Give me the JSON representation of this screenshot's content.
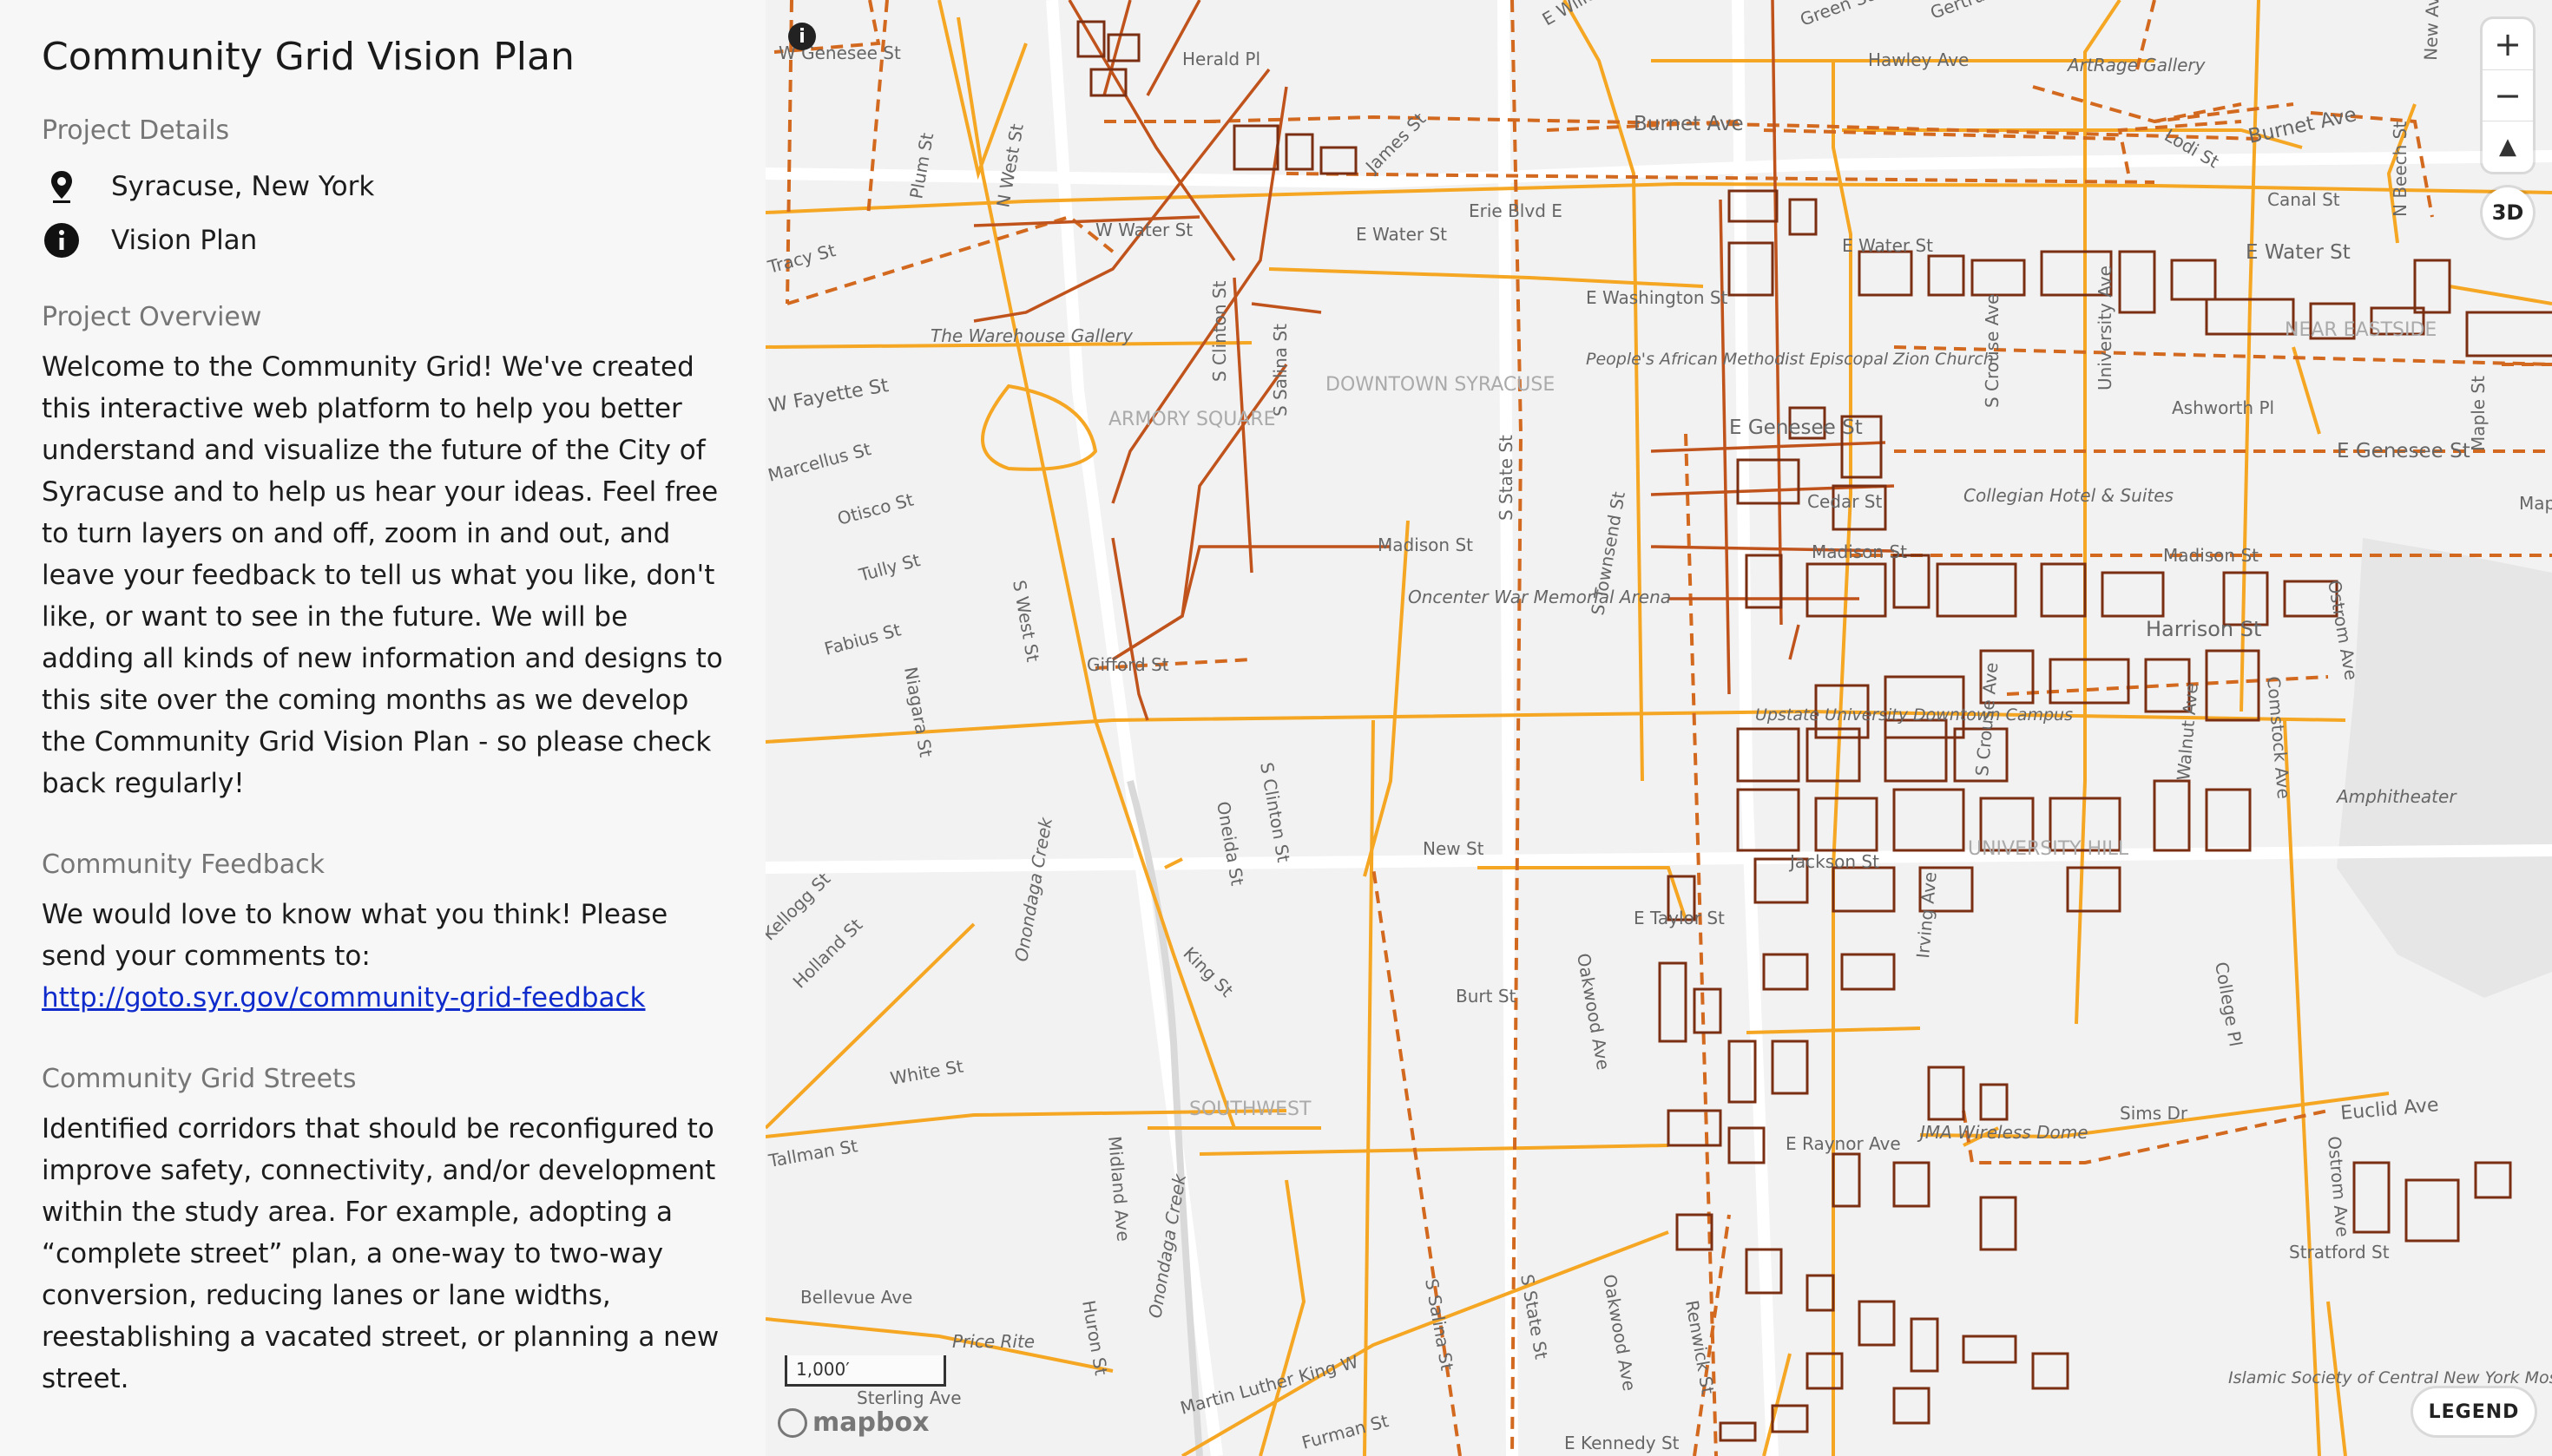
{
  "sidebar": {
    "title": "Community Grid Vision Plan",
    "details_heading": "Project Details",
    "location": "Syracuse, New York",
    "plan_type": "Vision Plan",
    "overview_heading": "Project Overview",
    "overview_text": "Welcome to the Community Grid! We've created this interactive web platform to help you better understand and visualize the future of the City of Syracuse and to help us hear your ideas. Feel free to turn layers on and off, zoom in and out, and leave your feedback to tell us what you like, don't like, or want to see in the future. We will be adding all kinds of new information and designs to this site over the coming months as we develop the Community Grid Vision Plan - so please check back regularly!",
    "feedback_heading": "Community Feedback",
    "feedback_text": "We would love to know what you think! Please send your comments to: ",
    "feedback_link": "http://goto.syr.gov/community-grid-feedback",
    "streets_heading": "Community Grid Streets",
    "streets_text": "Identified corridors that should be reconfigured to improve safety, connectivity, and/or development within the study area. For example, adopting a “complete street” plan, a one-way to two-way conversion, reducing lanes or lane widths, reestablishing a vacated street, or planning a new street."
  },
  "map": {
    "controls": {
      "zoom_in": "+",
      "zoom_out": "−",
      "compass": "▲",
      "view_3d": "3D",
      "legend": "LEGEND",
      "info": "i"
    },
    "scale_label": "1,000′",
    "attribution": "mapbox",
    "colors": {
      "corridor": "#f5a623",
      "dashed": "#d2691e",
      "brown": "#c0531c",
      "building": "#7a2e12"
    },
    "labels": {
      "w_genesee": "W Genesee St",
      "herald_pl": "Herald Pl",
      "e_willow": "E Willow St",
      "hawley_ave": "Hawley Ave",
      "artrage": "ArtRage Gallery",
      "burnet_ave_top": "Burnet Ave",
      "burnet_ave_right": "Burnet Ave",
      "lodi_st": "Lodi St",
      "n_beech": "N Beech St",
      "plum_st": "Plum St",
      "n_west": "N West St",
      "james_st": "James St",
      "erie_blvd": "Erie Blvd E",
      "canal_st": "Canal St",
      "tracy_st": "Tracy St",
      "w_water": "W Water St",
      "e_water_mid": "E Water St",
      "e_water_upper": "E Water St",
      "e_water_right": "E Water St",
      "e_washington": "E Washington St",
      "near_eastside": "NEAR EASTSIDE",
      "warehouse": "The Warehouse Gallery",
      "s_clinton_top": "S Clinton St",
      "s_salina": "S Salina St",
      "downtown": "DOWNTOWN SYRACUSE",
      "peoples_church": "People's African Methodist Episcopal Zion Church",
      "crouse_top": "S Crouse Ave",
      "university_ave_top": "University Ave",
      "w_fayette": "W Fayette St",
      "armory_square": "ARMORY SQUARE",
      "ashworth": "Ashworth Pl",
      "maple_st": "Maple St",
      "marcellus": "Marcellus St",
      "s_state_top": "S State St",
      "s_townsend": "S Townsend St",
      "e_genesee_mid": "E Genesee St",
      "e_genesee_right": "E Genesee St",
      "otisco": "Otisco St",
      "cedar_st": "Cedar St",
      "hotel": "Collegian Hotel & Suites",
      "tully": "Tully St",
      "madison_w": "Madison St",
      "madison_mid": "Madison St",
      "madison_e": "Madison St",
      "s_west_st": "S West St",
      "oncenter": "Oncenter War Memorial Arena",
      "harrison": "Harrison St",
      "ostrom_top": "Ostrom Ave",
      "fabius": "Fabius St",
      "niagara": "Niagara St",
      "gifford": "Gifford St",
      "upstate": "Upstate University Downtown Campus",
      "walnut": "Walnut Ave",
      "comstock": "Comstock Ave",
      "crouse_low": "S Crouse Ave",
      "s_clinton_low": "S Clinton St",
      "oneida": "Oneida St",
      "onondaga_top": "Onondaga Creek",
      "amphitheater": "Amphitheater",
      "new_st": "New St",
      "jackson_st": "Jackson St",
      "university_hill": "UNIVERSITY HILL",
      "kellogg": "Kellogg St",
      "holland": "Holland St",
      "e_taylor": "E Taylor St",
      "irving": "Irving Ave",
      "king_st": "King St",
      "burt_st": "Burt St",
      "oakwood_top": "Oakwood Ave",
      "college_pl": "College Pl",
      "white_st": "White St",
      "southwest": "SOUTHWEST",
      "sims_dr": "Sims Dr",
      "euclid": "Euclid Ave",
      "tallman": "Tallman St",
      "midland": "Midland Ave",
      "e_raynor": "E Raynor Ave",
      "jma": "JMA Wireless Dome",
      "ostrom_low": "Ostrom Ave",
      "onondaga_low": "Onondaga Creek",
      "stratford": "Stratford St",
      "bellevue": "Bellevue Ave",
      "huron": "Huron St",
      "price_rite": "Price Rite",
      "mlk": "Martin Luther King W",
      "s_salina_low": "S Salina St",
      "s_state_low": "S State St",
      "oakwood_low": "Oakwood Ave",
      "renwick": "Renwick St",
      "islamic": "Islamic Society of Central New York Mosque",
      "sterling": "Sterling Ave",
      "furman": "Furman St",
      "e_kennedy": "E Kennedy St",
      "green_st": "Green St",
      "gertrude": "Gertrude St",
      "new_ave": "New Ave",
      "map_edge": "Map"
    }
  }
}
